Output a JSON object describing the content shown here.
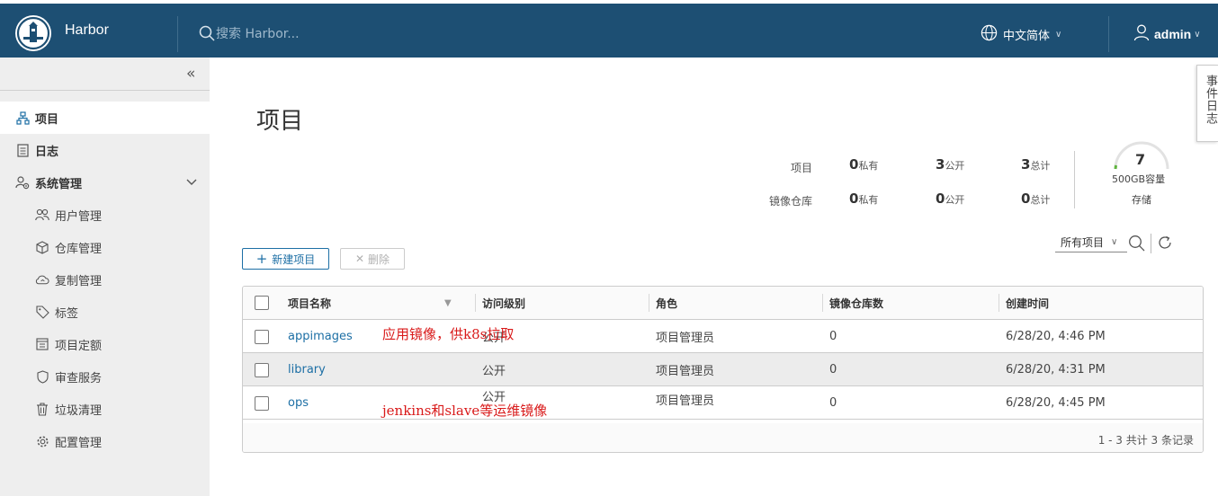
{
  "header": {
    "brand": "Harbor",
    "search_placeholder": "搜索 Harbor...",
    "language": "中文简体",
    "user": "admin"
  },
  "sidebar": {
    "items": [
      {
        "label": "项目",
        "icon": "project-icon",
        "active": true
      },
      {
        "label": "日志",
        "icon": "log-icon"
      },
      {
        "label": "系统管理",
        "icon": "system-admin-icon",
        "expanded": true
      }
    ],
    "sub_items": [
      {
        "label": "用户管理",
        "icon": "users-icon"
      },
      {
        "label": "仓库管理",
        "icon": "cube-icon"
      },
      {
        "label": "复制管理",
        "icon": "cloud-sync-icon"
      },
      {
        "label": "标签",
        "icon": "tag-icon"
      },
      {
        "label": "项目定额",
        "icon": "quota-icon"
      },
      {
        "label": "审查服务",
        "icon": "shield-icon"
      },
      {
        "label": "垃圾清理",
        "icon": "trash-icon"
      },
      {
        "label": "配置管理",
        "icon": "gear-icon"
      }
    ]
  },
  "main": {
    "title": "项目",
    "stats": {
      "projects_label": "项目",
      "repos_label": "镜像仓库",
      "projects": {
        "private": "0",
        "public": "3",
        "total": "3"
      },
      "repos": {
        "private": "0",
        "public": "0",
        "total": "0"
      },
      "private_suffix": "私有",
      "public_suffix": "公开",
      "total_suffix": "总计"
    },
    "storage": {
      "count": "7",
      "capacity": "500GB容量",
      "label": "存储"
    },
    "filter": {
      "selected": "所有项目"
    },
    "new_project_label": "新建项目",
    "delete_label": "删除",
    "table": {
      "headers": [
        "项目名称",
        "访问级别",
        "角色",
        "镜像仓库数",
        "创建时间"
      ],
      "rows": [
        {
          "name": "appimages",
          "access": "公开",
          "role": "项目管理员",
          "repos": "0",
          "created": "6/28/20, 4:46 PM"
        },
        {
          "name": "library",
          "access": "公开",
          "role": "项目管理员",
          "repos": "0",
          "created": "6/28/20, 4:31 PM"
        },
        {
          "name": "ops",
          "access": "公开",
          "role": "项目管理员",
          "repos": "0",
          "created": "6/28/20, 4:45 PM"
        }
      ],
      "footer": "1 - 3 共计 3 条记录"
    },
    "annotations": [
      "应用镜像，供k8s拉取",
      "jenkins和slave等运维镜像"
    ]
  },
  "event_log_tab": "事件日志",
  "colors": {
    "header_bg": "#1d4f73",
    "link": "#1d6fa5",
    "annotation": "#d91a1a",
    "sidebar_bg": "#eeeeee"
  }
}
